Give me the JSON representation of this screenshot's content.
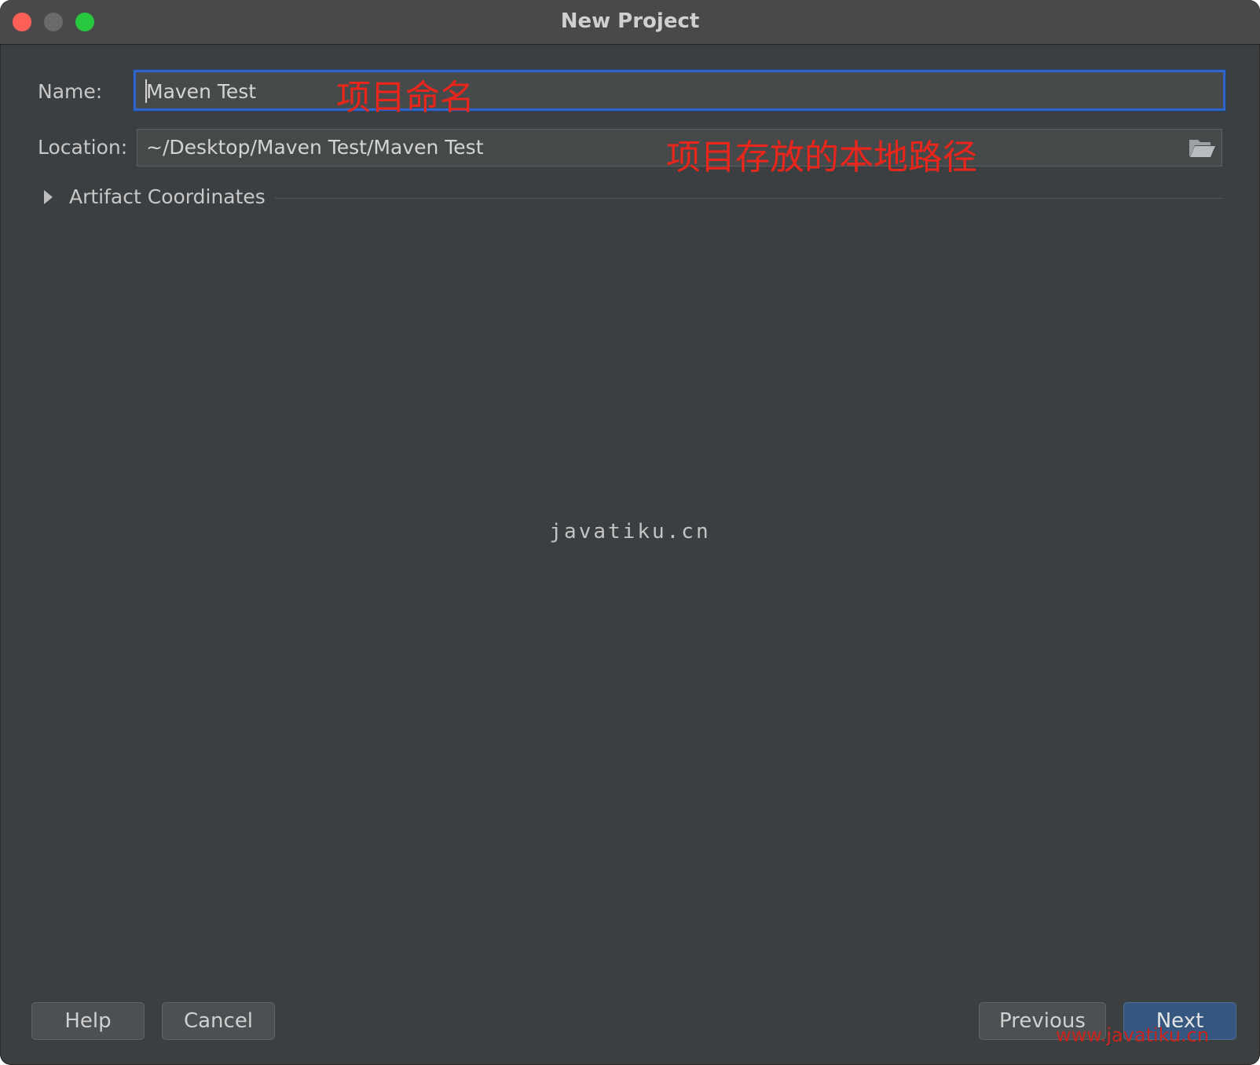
{
  "window": {
    "title": "New Project"
  },
  "form": {
    "name_label": "Name:",
    "name_value": "Maven Test",
    "name_annotation": "项目命名",
    "location_label": "Location:",
    "location_value": "~/Desktop/Maven Test/Maven Test",
    "location_annotation": "项目存放的本地路径",
    "artifact_section": "Artifact Coordinates"
  },
  "watermarks": {
    "center": "javatiku.cn",
    "corner": "www.javatiku.cn"
  },
  "buttons": {
    "help": "Help",
    "cancel": "Cancel",
    "previous": "Previous",
    "next": "Next"
  },
  "colors": {
    "background": "#3c3f41",
    "focus": "#2f65ca",
    "annotation": "#e8261c",
    "primary_button": "#365880"
  }
}
